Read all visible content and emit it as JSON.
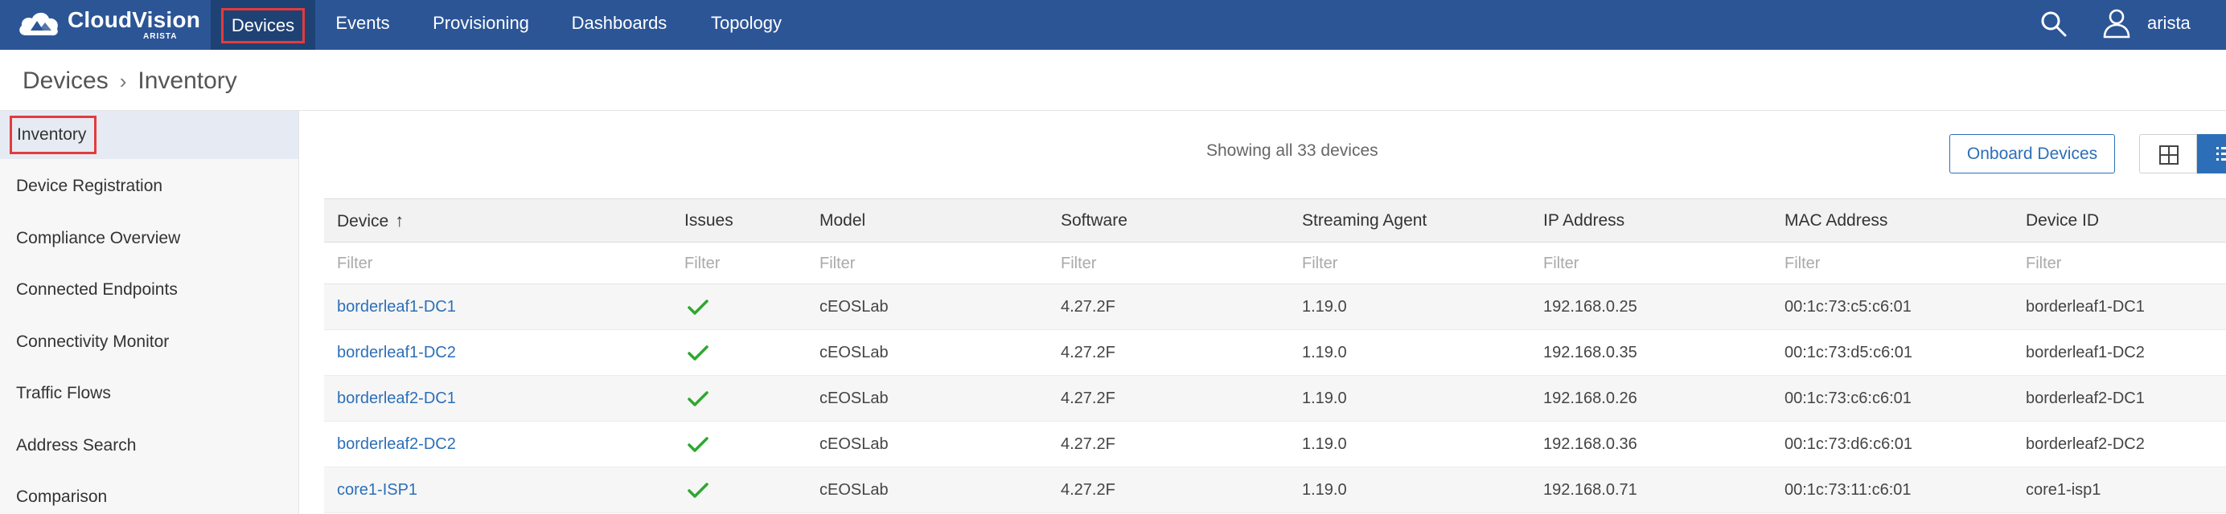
{
  "app": {
    "brand": "CloudVision",
    "brand_sub": "ARISTA",
    "nav_tabs": [
      {
        "label": "Devices",
        "active": true
      },
      {
        "label": "Events"
      },
      {
        "label": "Provisioning"
      },
      {
        "label": "Dashboards"
      },
      {
        "label": "Topology"
      }
    ],
    "user": "arista",
    "accent_color": "#2c5596"
  },
  "breadcrumb": {
    "section": "Devices",
    "page": "Inventory"
  },
  "sidebar": {
    "items": [
      {
        "label": "Inventory",
        "active": true
      },
      {
        "label": "Device Registration"
      },
      {
        "label": "Compliance Overview"
      },
      {
        "label": "Connected Endpoints"
      },
      {
        "label": "Connectivity Monitor"
      },
      {
        "label": "Traffic Flows"
      },
      {
        "label": "Address Search"
      },
      {
        "label": "Comparison"
      }
    ]
  },
  "main": {
    "showing_text": "Showing all 33 devices",
    "onboard_label": "Onboard Devices"
  },
  "table": {
    "columns": [
      "Device",
      "Issues",
      "Model",
      "Software",
      "Streaming Agent",
      "IP Address",
      "MAC Address",
      "Device ID"
    ],
    "sort_indicator": "↑",
    "filter_placeholder": "Filter",
    "rows": [
      {
        "device": "borderleaf1-DC1",
        "issues": "ok",
        "model": "cEOSLab",
        "software": "4.27.2F",
        "agent": "1.19.0",
        "ip": "192.168.0.25",
        "mac": "00:1c:73:c5:c6:01",
        "device_id": "borderleaf1-DC1"
      },
      {
        "device": "borderleaf1-DC2",
        "issues": "ok",
        "model": "cEOSLab",
        "software": "4.27.2F",
        "agent": "1.19.0",
        "ip": "192.168.0.35",
        "mac": "00:1c:73:d5:c6:01",
        "device_id": "borderleaf1-DC2"
      },
      {
        "device": "borderleaf2-DC1",
        "issues": "ok",
        "model": "cEOSLab",
        "software": "4.27.2F",
        "agent": "1.19.0",
        "ip": "192.168.0.26",
        "mac": "00:1c:73:c6:c6:01",
        "device_id": "borderleaf2-DC1"
      },
      {
        "device": "borderleaf2-DC2",
        "issues": "ok",
        "model": "cEOSLab",
        "software": "4.27.2F",
        "agent": "1.19.0",
        "ip": "192.168.0.36",
        "mac": "00:1c:73:d6:c6:01",
        "device_id": "borderleaf2-DC2"
      },
      {
        "device": "core1-ISP1",
        "issues": "ok",
        "model": "cEOSLab",
        "software": "4.27.2F",
        "agent": "1.19.0",
        "ip": "192.168.0.71",
        "mac": "00:1c:73:11:c6:01",
        "device_id": "core1-isp1"
      }
    ]
  }
}
